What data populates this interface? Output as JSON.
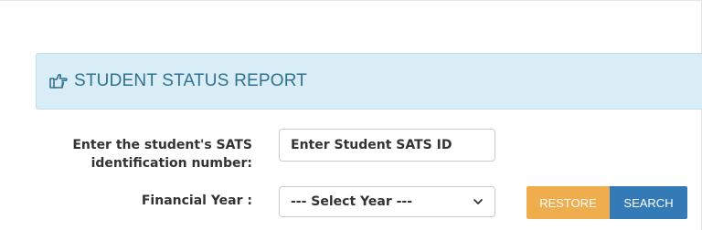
{
  "header": {
    "title": "STUDENT STATUS REPORT",
    "icon": "hand-pointer-icon",
    "background": "#d9edf7",
    "text_color": "#31708f"
  },
  "form": {
    "sats_label": "Enter the student's SATS identification number:",
    "sats_placeholder": "Enter Student SATS ID",
    "sats_value": "",
    "year_label": "Financial Year :",
    "year_selected": "--- Select Year ---"
  },
  "buttons": {
    "restore_label": "RESTORE",
    "restore_color": "#f0ad4e",
    "search_label": "SEARCH",
    "search_color": "#337ab7"
  }
}
